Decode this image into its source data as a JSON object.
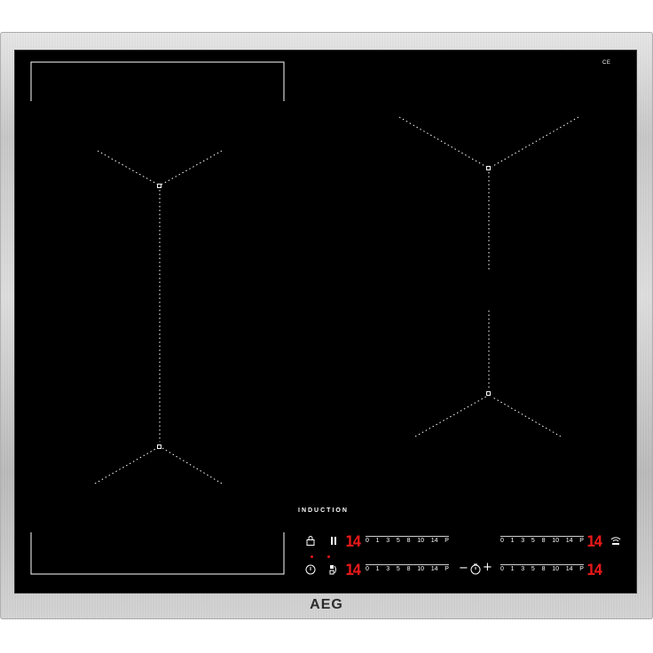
{
  "brand": "AEG",
  "technology_label": "INDUCTION",
  "ce_mark": "CE",
  "accent_color": "#e41818",
  "controls": {
    "zones": [
      {
        "id": "front-left",
        "display": "14",
        "scale": [
          "0",
          "1",
          "3",
          "5",
          "8",
          "10",
          "14",
          "P"
        ]
      },
      {
        "id": "rear-left",
        "display": "14",
        "scale": [
          "0",
          "1",
          "3",
          "5",
          "8",
          "10",
          "14",
          "P"
        ]
      },
      {
        "id": "rear-right",
        "display": "14",
        "scale": [
          "0",
          "1",
          "3",
          "5",
          "8",
          "10",
          "14",
          "P"
        ]
      },
      {
        "id": "front-right",
        "display": "14",
        "scale": [
          "0",
          "1",
          "3",
          "5",
          "8",
          "10",
          "14",
          "P"
        ]
      }
    ],
    "timer_minus": "−",
    "timer_plus": "+",
    "icons": [
      "lock-icon",
      "pause-icon",
      "power-icon",
      "bridge-icon",
      "timer-icon",
      "hob2hood-icon"
    ]
  }
}
